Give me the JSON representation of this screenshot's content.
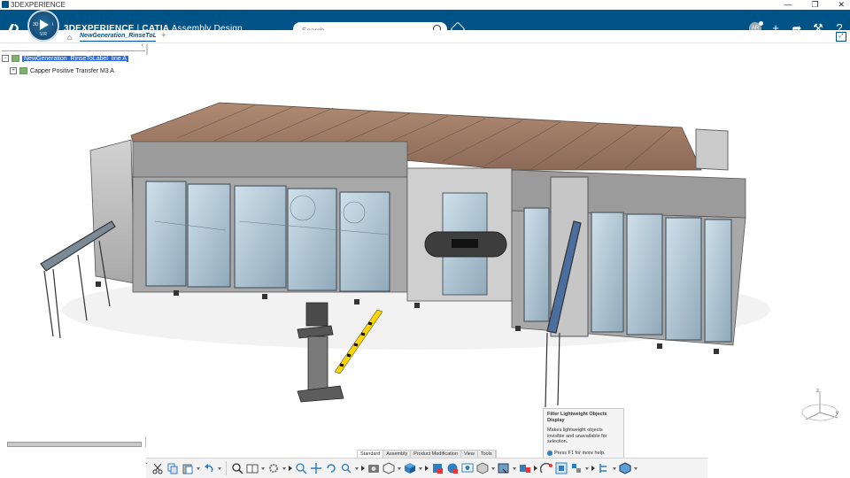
{
  "window": {
    "title": "3DEXPERIENCE",
    "controls": [
      "—",
      "❐",
      "✕"
    ]
  },
  "topbar": {
    "brand_ds": "3DS",
    "brand_3dx": "3DEXPERIENCE",
    "brand_sep": " | ",
    "brand_catia": "CATIA",
    "brand_app": "Assembly Design",
    "compass_version": "V.R",
    "compass_left": "3D",
    "compass_right": "i",
    "search_placeholder": "Search",
    "avatar_initials": "AR"
  },
  "tabs": [
    {
      "label": "NewGeneration_RinseToLabel_line A"
    }
  ],
  "tree": {
    "root": "NewGeneration_RinseToLabel_line A",
    "child": "Capper Positive Transfer M3 A"
  },
  "tooltip": {
    "title": "Filter Lightweight Objects Display",
    "description": "Makes lightweight objects invisible and unavailable for selection.",
    "help": "Press F1 for more help."
  },
  "action_bar": {
    "tabs": [
      "Standard",
      "Assembly",
      "Product Modification",
      "View",
      "Tools"
    ],
    "active": "Standard",
    "tools": [
      "cut-icon",
      "copy-icon",
      "paste-icon",
      "undo-icon",
      "fit-all-icon",
      "book-icon",
      "settings-icon",
      "zoom-icon",
      "pan-icon",
      "rotate-icon",
      "zoom-area-icon",
      "capture-icon",
      "render-icon",
      "cube-view-icon",
      "insert-icon",
      "globe-icon",
      "display-icon",
      "hide-icon",
      "filter-lightweight-icon",
      "explode-icon",
      "manipulate-icon",
      "compare-icon",
      "tree-icon",
      "tools-icon"
    ]
  },
  "colors": {
    "topbar": "#005386",
    "selection": "#2f6bd8"
  }
}
